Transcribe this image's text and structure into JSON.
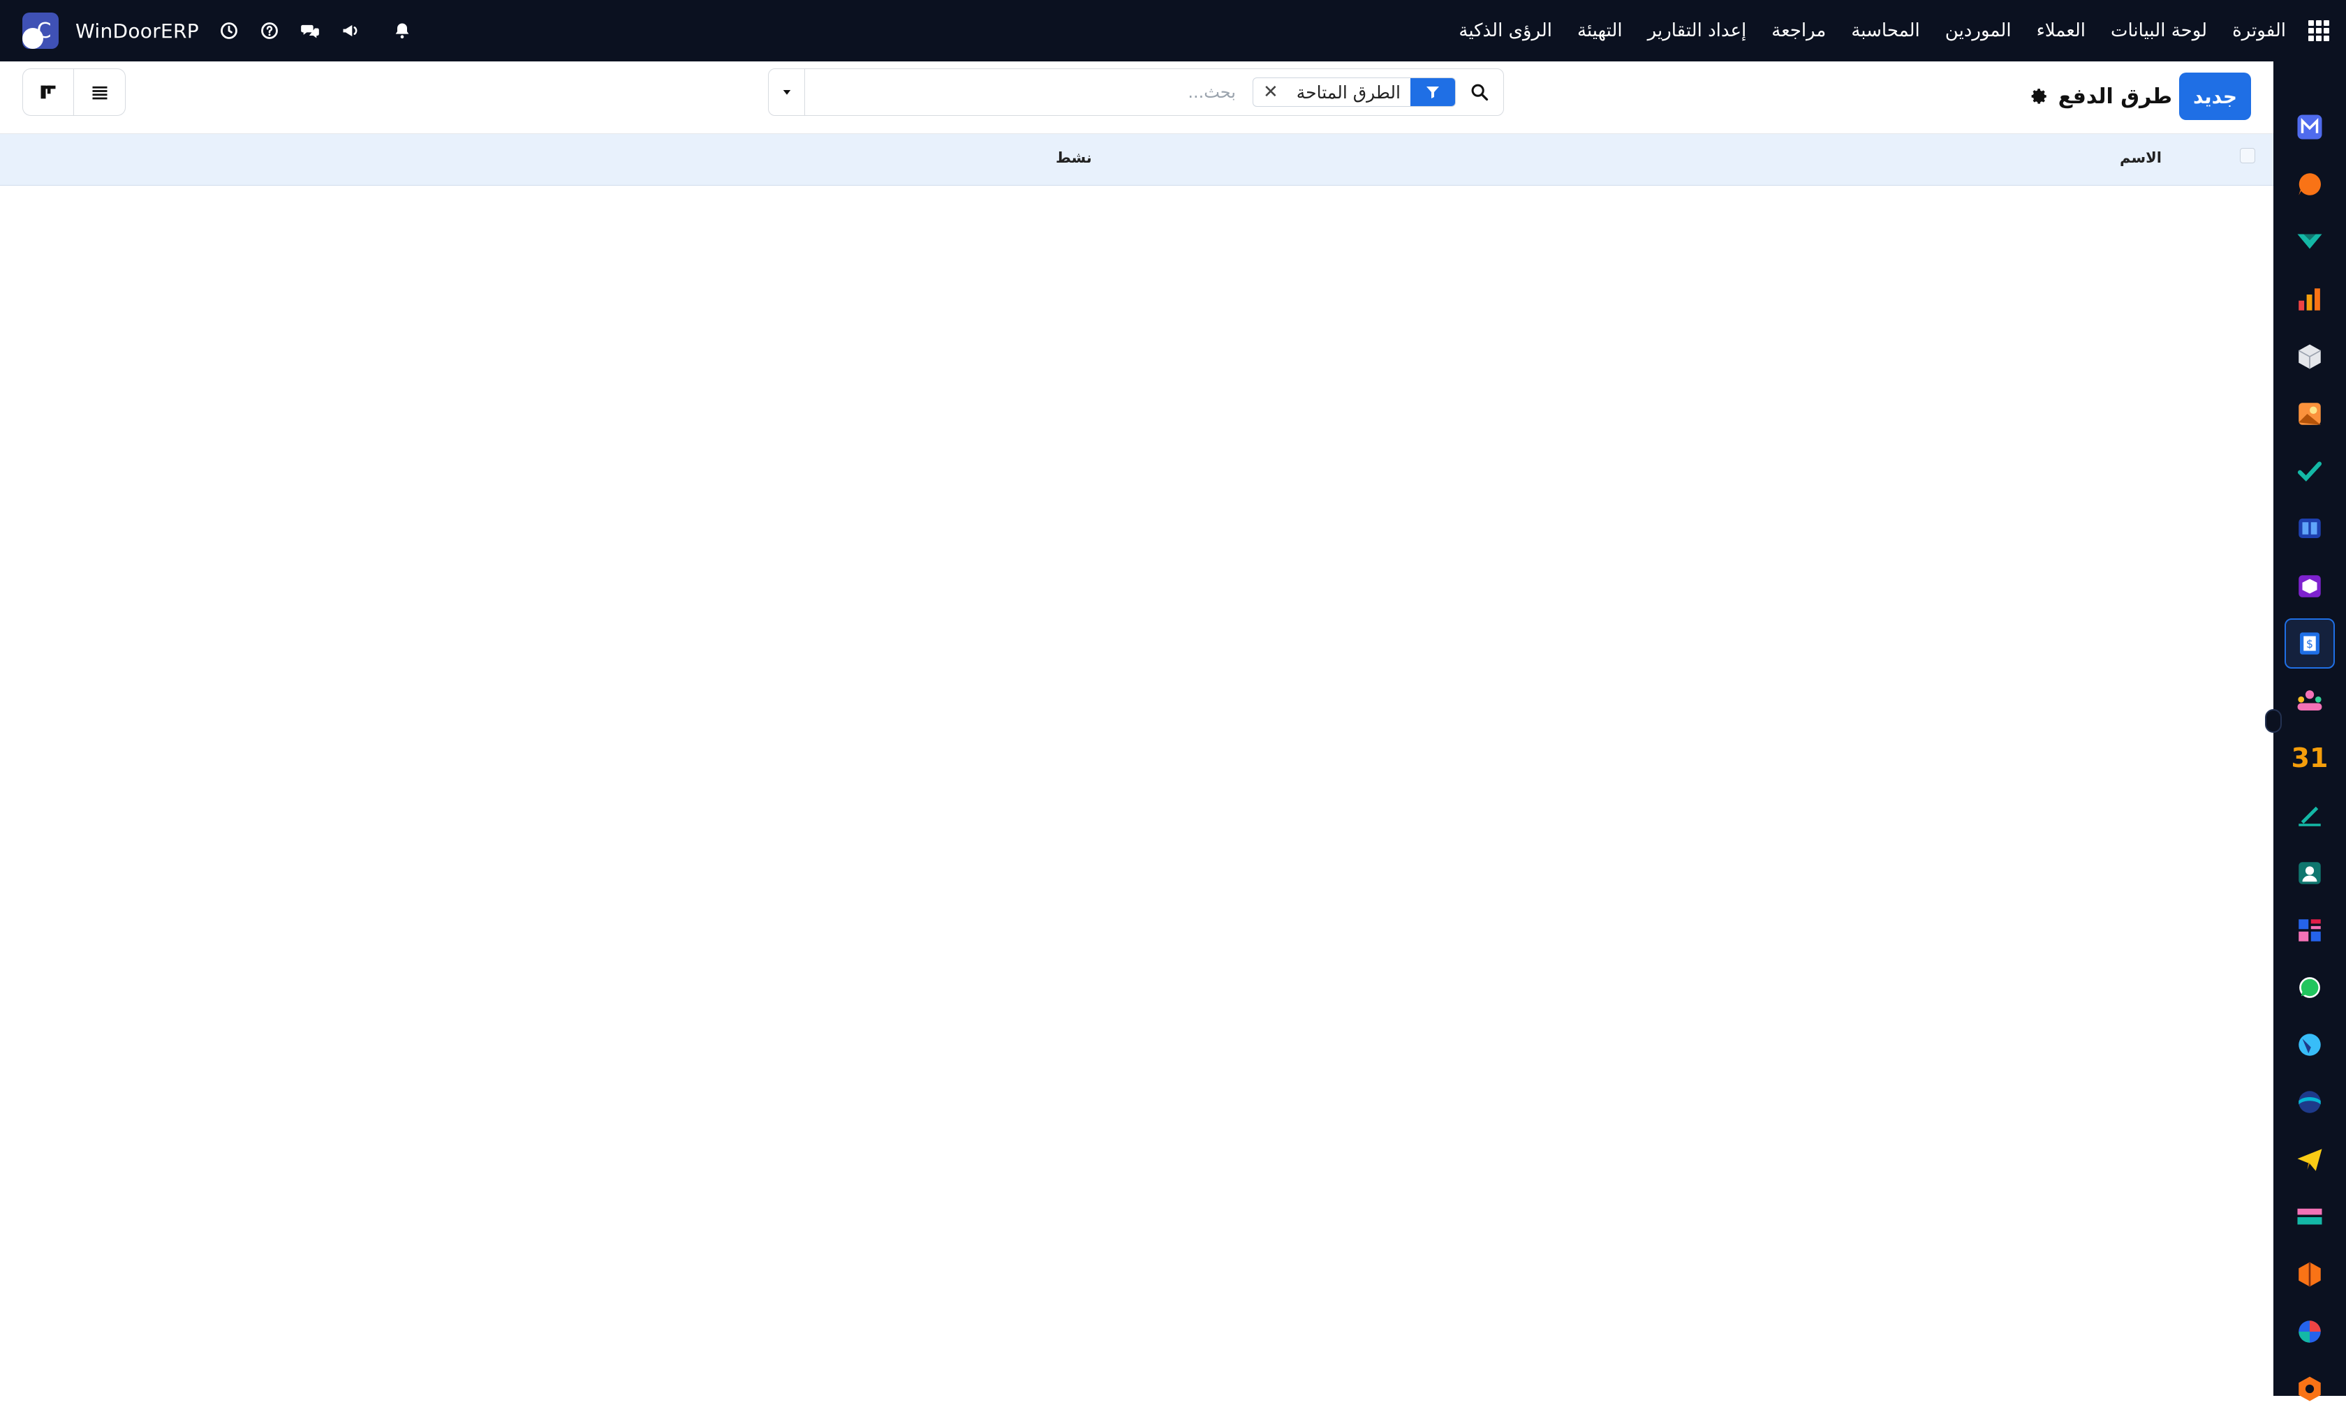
{
  "topbar": {
    "brand": "WinDoorERP",
    "logo_letter": "C",
    "menu": [
      "الفوترة",
      "لوحة البيانات",
      "العملاء",
      "الموردين",
      "المحاسبة",
      "مراجعة",
      "إعداد التقارير",
      "التهيئة",
      "الرؤى الذكية"
    ],
    "icons": [
      "clock-icon",
      "help-icon",
      "chat-icon",
      "megaphone-icon",
      "bell-icon",
      "apps-grid-icon"
    ]
  },
  "control_bar": {
    "new_label": "جديد",
    "title": "طرق الدفع",
    "search": {
      "placeholder": "بحث...",
      "value": "",
      "facet_label": "الطرق المتاحة"
    },
    "view_modes": [
      "kanban-view-icon",
      "list-view-icon"
    ]
  },
  "table": {
    "columns": [
      "الاسم",
      "نشط"
    ],
    "rows": []
  },
  "sidebar_apps": [
    {
      "icon": "app-m-icon",
      "color": "#4f6bed"
    },
    {
      "icon": "app-chat-bubble-icon",
      "color": "#f97316"
    },
    {
      "icon": "app-teal-arrow-icon",
      "color": "#14b8a6"
    },
    {
      "icon": "app-bar-chart-icon",
      "color": "#f59e0b"
    },
    {
      "icon": "app-cube-icon",
      "color": "#e5e7eb"
    },
    {
      "icon": "app-photo-icon",
      "color": "#f59e0b"
    },
    {
      "icon": "app-check-icon",
      "color": "#14b8a6"
    },
    {
      "icon": "app-book-icon",
      "color": "#60a5fa"
    },
    {
      "icon": "app-box-icon",
      "color": "#c084fc"
    },
    {
      "icon": "app-invoice-icon",
      "color": "#1f6fe5",
      "active": true
    },
    {
      "icon": "app-team-icon",
      "color": "#f472b6"
    },
    {
      "icon": "app-calendar-icon",
      "text": "31",
      "color": "#f59e0b"
    },
    {
      "icon": "app-sign-icon",
      "color": "#14b8a6"
    },
    {
      "icon": "app-contacts-icon",
      "color": "#14b8a6"
    },
    {
      "icon": "app-dashboard-blocks-icon",
      "color": "#e11d48"
    },
    {
      "icon": "app-whatsapp-icon",
      "color": "#22c55e"
    },
    {
      "icon": "app-discuss-icon",
      "color": "#38bdf8"
    },
    {
      "icon": "app-wave-icon",
      "color": "#06b6d4"
    },
    {
      "icon": "app-send-icon",
      "color": "#facc15"
    },
    {
      "icon": "app-bank-icon",
      "color": "#f472b6"
    },
    {
      "icon": "app-hexagon-icon",
      "color": "#f97316"
    },
    {
      "icon": "app-pie-icon",
      "color": "#ef4444"
    },
    {
      "icon": "app-settings-hex-icon",
      "color": "#f97316"
    }
  ]
}
